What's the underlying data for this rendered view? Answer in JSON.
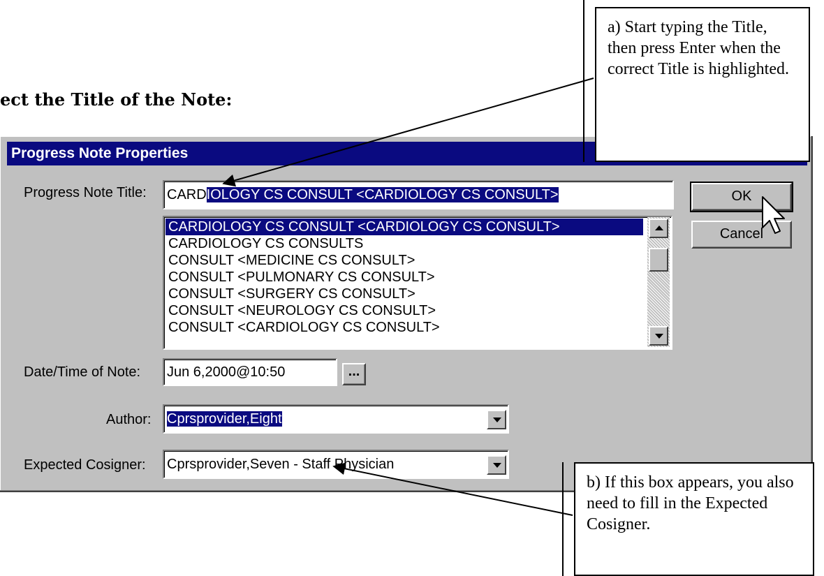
{
  "heading": "ect the Title of the Note:",
  "dialog": {
    "title": "Progress Note Properties",
    "title_label": "Progress Note Title:",
    "title_value_typed": "CARD",
    "title_value_highlight": "IOLOGY CS CONSULT  <CARDIOLOGY CS CONSULT>",
    "title_list": [
      "CARDIOLOGY CS CONSULT  <CARDIOLOGY CS CONSULT>",
      "CARDIOLOGY CS CONSULTS",
      "CONSULT  <MEDICINE CS CONSULT>",
      "CONSULT  <PULMONARY CS CONSULT>",
      "CONSULT  <SURGERY CS CONSULT>",
      "CONSULT  <NEUROLOGY CS CONSULT>",
      "CONSULT  <CARDIOLOGY CS CONSULT>"
    ],
    "date_label": "Date/Time of Note:",
    "date_value": "Jun 6,2000@10:50",
    "date_button": "...",
    "author_label": "Author:",
    "author_value": "Cprsprovider,Eight",
    "cosigner_label": "Expected Cosigner:",
    "cosigner_value": "Cprsprovider,Seven - Staff Physician",
    "ok_label": "OK",
    "cancel_label": "Cancel"
  },
  "callouts": {
    "a": "a) Start typing the Title, then press Enter when the correct Title is highlighted.",
    "b": "b) If this box appears, you also need to fill in the Expected Cosigner."
  },
  "colors": {
    "titlebar": "#0a0a80",
    "highlight": "#0a0a80",
    "dialog_face": "#c0c0c0"
  }
}
